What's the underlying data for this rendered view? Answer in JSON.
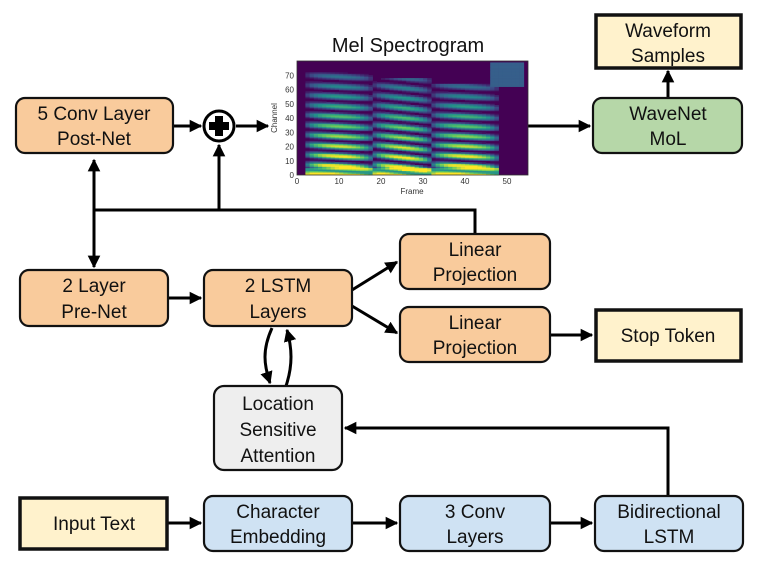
{
  "colors": {
    "decoder": "#f9cb9c",
    "encoder": "#cfe2f3",
    "vocoder": "#b6d7a8",
    "io": "#fff2cc",
    "attention": "#eeeeee"
  },
  "blocks": {
    "postnet": [
      "5 Conv Layer",
      "Post-Net"
    ],
    "prenet": [
      "2 Layer",
      "Pre-Net"
    ],
    "lstm": [
      "2 LSTM",
      "Layers"
    ],
    "linear1": [
      "Linear",
      "Projection"
    ],
    "linear2": [
      "Linear",
      "Projection"
    ],
    "stop": "Stop Token",
    "attention": [
      "Location",
      "Sensitive",
      "Attention"
    ],
    "input": "Input Text",
    "embedding": [
      "Character",
      "Embedding"
    ],
    "conv": [
      "3 Conv",
      "Layers"
    ],
    "bilstm": [
      "Bidirectional",
      "LSTM"
    ],
    "wavenet": [
      "WaveNet",
      "MoL"
    ],
    "waveform": [
      "Waveform",
      "Samples"
    ]
  },
  "spectrogram": {
    "title": "Mel Spectrogram",
    "xlabel": "Frame",
    "ylabel": "Channel",
    "xticks": [
      "0",
      "10",
      "20",
      "30",
      "40",
      "50"
    ],
    "yticks": [
      "0",
      "10",
      "20",
      "30",
      "40",
      "50",
      "60",
      "70"
    ]
  },
  "icons": {
    "sum": "plus-circle-icon"
  }
}
